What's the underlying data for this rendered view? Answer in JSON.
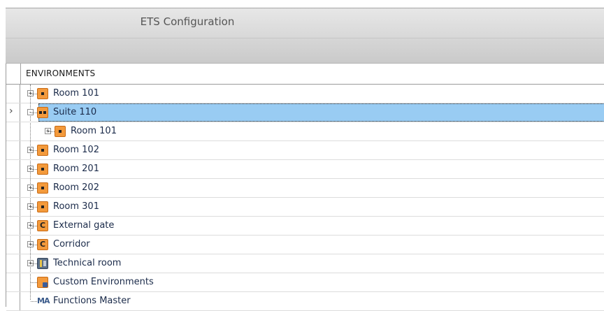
{
  "panel": {
    "title": "ETS Configuration"
  },
  "grid": {
    "column_header": "ENVIRONMENTS",
    "rows": [
      {
        "label": "Room 101",
        "icon": "room-icon",
        "level": 0,
        "expander": "+",
        "selected": false
      },
      {
        "label": "Suite 110",
        "icon": "suite-icon",
        "level": 0,
        "expander": "−",
        "selected": true
      },
      {
        "label": "Room 101",
        "icon": "room-icon",
        "level": 1,
        "expander": "+",
        "selected": false
      },
      {
        "label": "Room 102",
        "icon": "room-icon",
        "level": 0,
        "expander": "+",
        "selected": false
      },
      {
        "label": "Room 201",
        "icon": "room-icon",
        "level": 0,
        "expander": "+",
        "selected": false
      },
      {
        "label": "Room 202",
        "icon": "room-icon",
        "level": 0,
        "expander": "+",
        "selected": false
      },
      {
        "label": "Room 301",
        "icon": "room-icon",
        "level": 0,
        "expander": "+",
        "selected": false
      },
      {
        "label": "External gate",
        "icon": "corridor-icon",
        "icon_text": "C",
        "level": 0,
        "expander": "+",
        "selected": false
      },
      {
        "label": "Corridor",
        "icon": "corridor-icon",
        "icon_text": "C",
        "level": 0,
        "expander": "+",
        "selected": false
      },
      {
        "label": "Technical room",
        "icon": "technical-room-icon",
        "level": 0,
        "expander": "+",
        "selected": false
      },
      {
        "label": "Custom Environments",
        "icon": "custom-environments-icon",
        "level": 0,
        "expander": "",
        "selected": false
      },
      {
        "label": "Functions Master",
        "icon": "functions-master-icon",
        "icon_text": "MA",
        "level": 0,
        "expander": "",
        "selected": false
      }
    ]
  },
  "colors": {
    "selection": "#99ccf3",
    "room_icon": "#f39a3c",
    "label_text": "#1b2b4a"
  }
}
